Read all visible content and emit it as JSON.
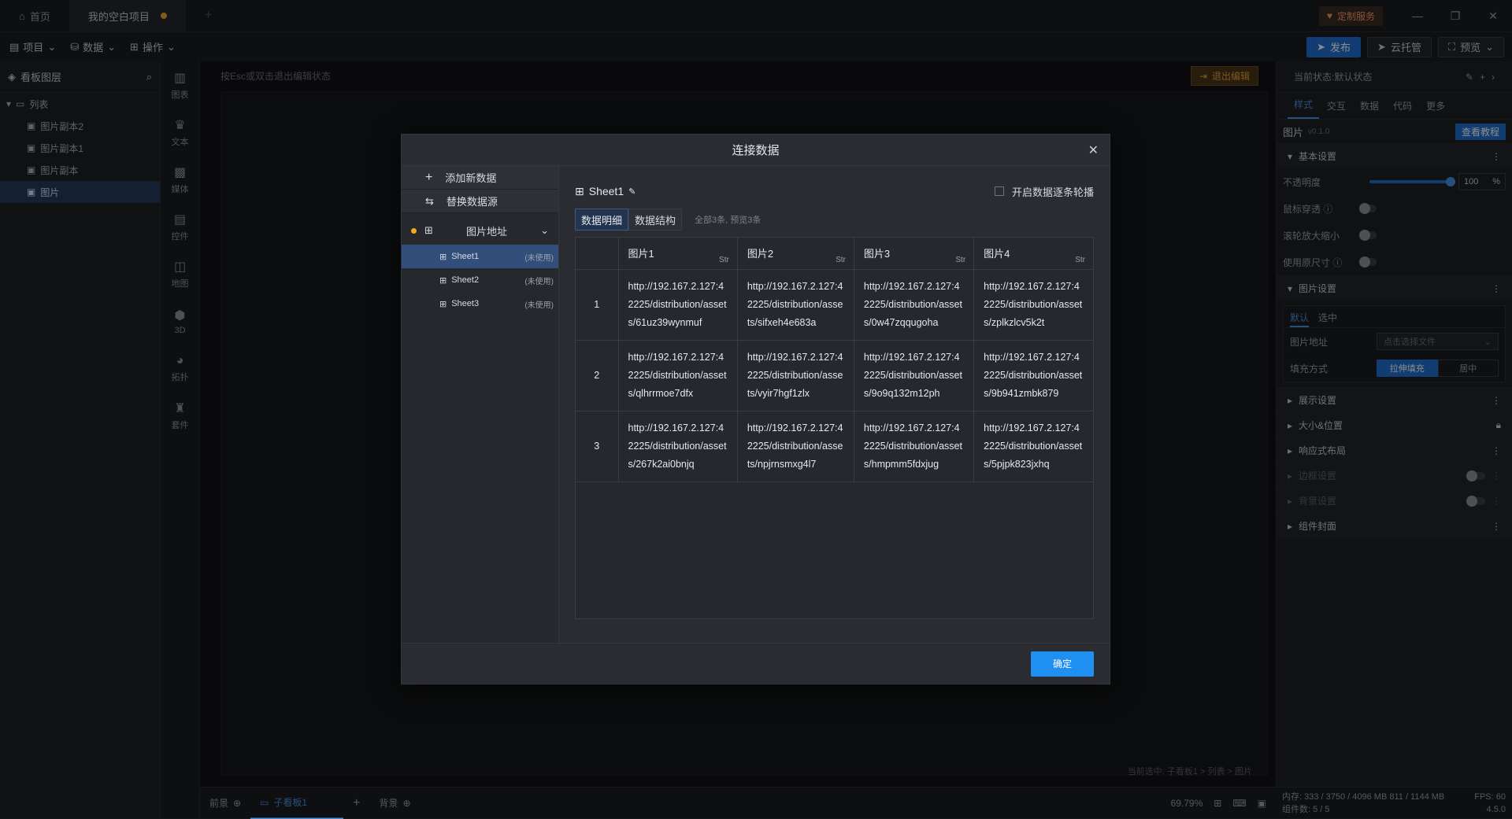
{
  "titlebar": {
    "tabs": [
      {
        "label": "首页"
      },
      {
        "label": "我的空白项目"
      }
    ],
    "custom_service": "定制服务",
    "win": {
      "min": "—",
      "restore": "❐",
      "close": "✕"
    }
  },
  "toolbar": {
    "menus": [
      {
        "label": "项目"
      },
      {
        "label": "数据"
      },
      {
        "label": "操作"
      }
    ],
    "publish": "发布",
    "cloud": "云托管",
    "preview": "预览"
  },
  "layers": {
    "title": "看板图层",
    "group": "列表",
    "items": [
      {
        "label": "图片副本2"
      },
      {
        "label": "图片副本1"
      },
      {
        "label": "图片副本"
      },
      {
        "label": "图片"
      }
    ]
  },
  "rail": {
    "items": [
      {
        "label": "图表"
      },
      {
        "label": "文本"
      },
      {
        "label": "媒体"
      },
      {
        "label": "控件"
      },
      {
        "label": "地图"
      },
      {
        "label": "3D"
      },
      {
        "label": "拓扑"
      },
      {
        "label": "套件"
      }
    ]
  },
  "canvas": {
    "hint": "按Esc或双击退出编辑状态",
    "exit_edit": "退出编辑",
    "breadcrumb": "当前选中: 子看板1 > 列表 > 图片"
  },
  "bottombar": {
    "foreground": "前景",
    "subboard": "子看板1",
    "background": "背景",
    "zoom": "69.79%"
  },
  "rpanel": {
    "state_label": "当前状态:默认状态",
    "tabs": [
      {
        "label": "样式"
      },
      {
        "label": "交互"
      },
      {
        "label": "数据"
      },
      {
        "label": "代码"
      },
      {
        "label": "更多"
      }
    ],
    "component": "图片",
    "version": "v0.1.0",
    "tutorial": "查看教程",
    "basic": {
      "title": "基本设置",
      "opacity_label": "不透明度",
      "opacity_value": "100",
      "opacity_unit": "%",
      "opacity_level": 1.0,
      "mouse_through": "鼠标穿透",
      "wheel_zoom": "滚轮放大缩小",
      "original_size": "使用原尺寸"
    },
    "image": {
      "title": "图片设置",
      "tab_default": "默认",
      "tab_selected": "选中",
      "addr_label": "图片地址",
      "addr_placeholder": "点击选择文件",
      "fill_label": "填充方式",
      "fill_stretch": "拉伸填充",
      "fill_center": "居中"
    },
    "sections": [
      {
        "label": "展示设置"
      },
      {
        "label": "大小&位置"
      },
      {
        "label": "响应式布局"
      },
      {
        "label": "边框设置"
      },
      {
        "label": "背景设置"
      },
      {
        "label": "组件封面"
      }
    ]
  },
  "statusbar": {
    "memory": "内存: 333 / 3750 / 4096 MB  811 / 1144 MB",
    "fps": "FPS: 60",
    "components": "组件数: 5 / 5",
    "version": "4.5.0"
  },
  "modal": {
    "title": "连接数据",
    "add_data": "添加新数据",
    "replace_source": "替换数据源",
    "source_name": "图片地址",
    "sheets": [
      {
        "name": "Sheet1",
        "status": "(未使用)"
      },
      {
        "name": "Sheet2",
        "status": "(未使用)"
      },
      {
        "name": "Sheet3",
        "status": "(未使用)"
      }
    ],
    "current_sheet": "Sheet1",
    "carousel_label": "开启数据逐条轮播",
    "tab_detail": "数据明细",
    "tab_structure": "数据结构",
    "count_text": "全部3条, 预览3条",
    "type_mark": "Str",
    "columns": [
      "图片1",
      "图片2",
      "图片3",
      "图片4"
    ],
    "rows": [
      {
        "idx": "1",
        "cells": [
          "http://192.167.2.127:42225/distribution/assets/61uz39wynmuf",
          "http://192.167.2.127:42225/distribution/assets/sifxeh4e683a",
          "http://192.167.2.127:42225/distribution/assets/0w47zqqugoha",
          "http://192.167.2.127:42225/distribution/assets/zplkzlcv5k2t"
        ]
      },
      {
        "idx": "2",
        "cells": [
          "http://192.167.2.127:42225/distribution/assets/qlhrrmoe7dfx",
          "http://192.167.2.127:42225/distribution/assets/vyir7hgf1zlx",
          "http://192.167.2.127:42225/distribution/assets/9o9q132m12ph",
          "http://192.167.2.127:42225/distribution/assets/9b941zmbk879"
        ]
      },
      {
        "idx": "3",
        "cells": [
          "http://192.167.2.127:42225/distribution/assets/267k2ai0bnjq",
          "http://192.167.2.127:42225/distribution/assets/npjrnsmxg4l7",
          "http://192.167.2.127:42225/distribution/assets/hmpmm5fdxjug",
          "http://192.167.2.127:42225/distribution/assets/5pjpk823jxhq"
        ]
      }
    ],
    "confirm": "确定"
  }
}
